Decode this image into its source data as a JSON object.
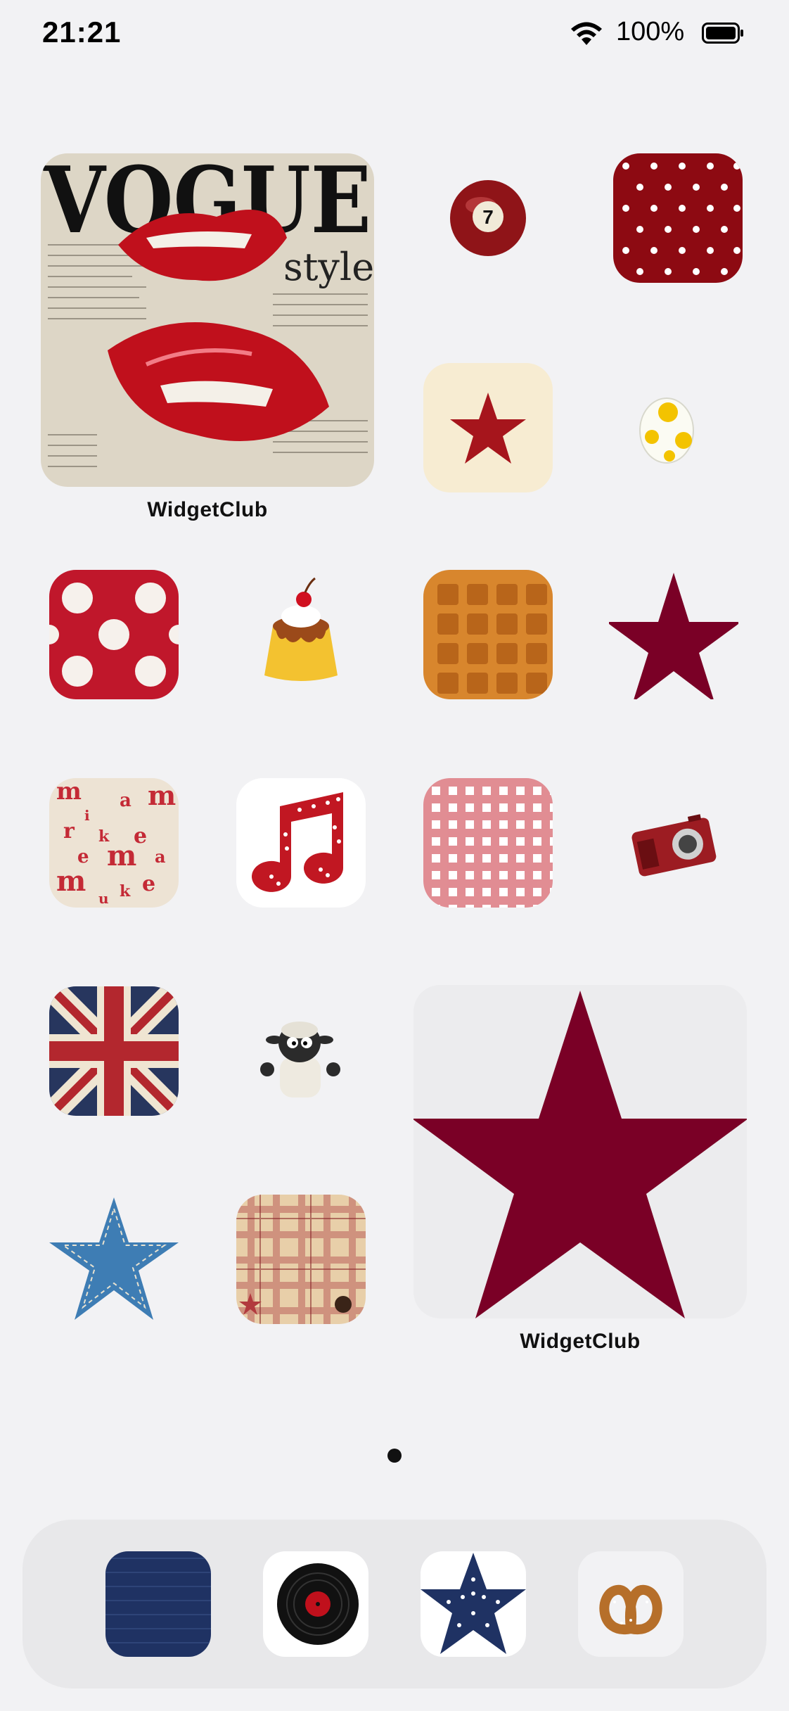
{
  "status_bar": {
    "time": "21:21",
    "battery_percent": "100%",
    "wifi_icon": "wifi-icon",
    "battery_icon": "battery-icon"
  },
  "widgets": [
    {
      "label": "WidgetClub",
      "image": "vogue-style-lips-photo",
      "headline": "VOGUE",
      "subheadline": "style"
    },
    {
      "label": "WidgetClub",
      "image": "large-burgundy-star"
    }
  ],
  "apps": [
    {
      "icon": "billiard-ball-7-icon",
      "text": "7"
    },
    {
      "icon": "red-polka-dot-icon"
    },
    {
      "icon": "red-star-on-cream-icon"
    },
    {
      "icon": "yoshi-egg-icon"
    },
    {
      "icon": "dice-polka-dot-icon"
    },
    {
      "icon": "pudding-icon"
    },
    {
      "icon": "waffle-icon"
    },
    {
      "icon": "burgundy-star-icon"
    },
    {
      "icon": "letters-pattern-icon"
    },
    {
      "icon": "music-note-icon"
    },
    {
      "icon": "gingham-icon"
    },
    {
      "icon": "camera-icon"
    },
    {
      "icon": "union-jack-icon"
    },
    {
      "icon": "shaun-the-sheep-icon"
    },
    {
      "icon": "denim-star-icon"
    },
    {
      "icon": "plaid-icon"
    }
  ],
  "page_indicator": {
    "pages": 1,
    "current": 1
  },
  "dock": [
    {
      "icon": "denim-square-icon"
    },
    {
      "icon": "vinyl-record-icon"
    },
    {
      "icon": "stars-star-icon"
    },
    {
      "icon": "pretzel-icon"
    }
  ],
  "colors": {
    "background": "#f2f2f4",
    "accent_red": "#c0172b",
    "burgundy": "#7a0026",
    "navy": "#1f3263"
  }
}
